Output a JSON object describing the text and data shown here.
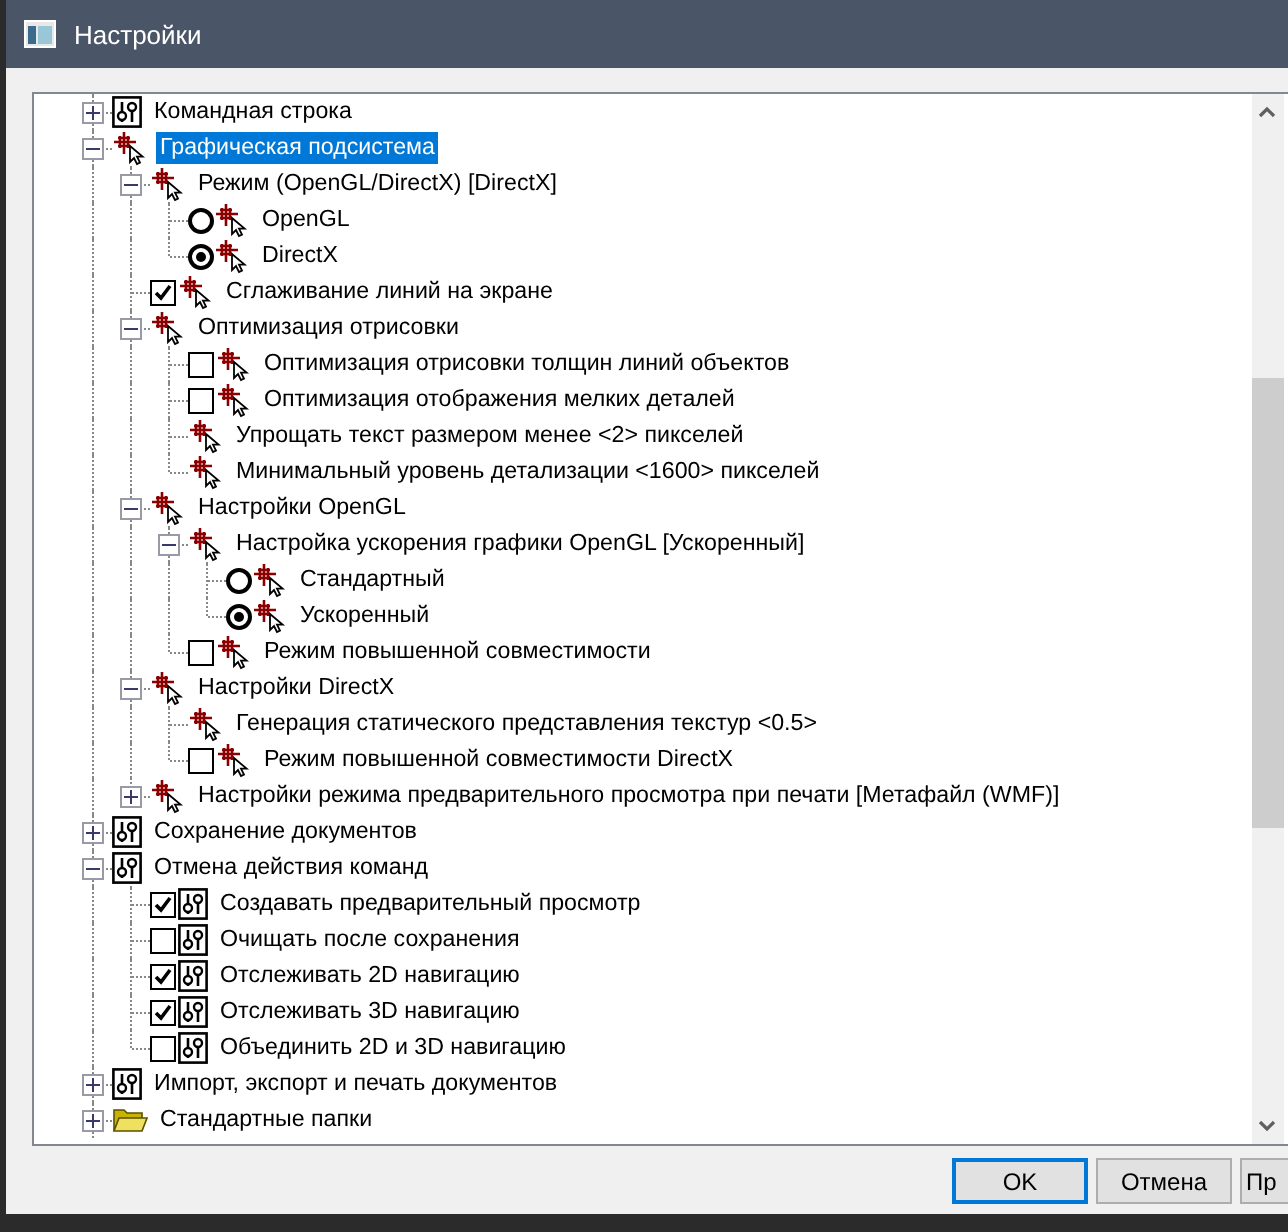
{
  "window": {
    "title": "Настройки"
  },
  "tree": {
    "items": [
      {
        "label": "Командная строка",
        "kind": "tool-node",
        "expanded": false,
        "selected": false
      },
      {
        "label": "Графическая подсистема",
        "kind": "cad-node",
        "expanded": true,
        "selected": true,
        "children": [
          {
            "label": "Режим (OpenGL/DirectX) [DirectX]",
            "kind": "cad-node",
            "expanded": true,
            "selected": false,
            "children": [
              {
                "label": "OpenGL",
                "kind": "cad-radio",
                "checked": false,
                "selected": false
              },
              {
                "label": "DirectX",
                "kind": "cad-radio",
                "checked": true,
                "selected": false
              }
            ]
          },
          {
            "label": "Сглаживание линий на экране",
            "kind": "cad-checkbox",
            "checked": true,
            "selected": false
          },
          {
            "label": "Оптимизация отрисовки",
            "kind": "cad-node",
            "expanded": true,
            "selected": false,
            "children": [
              {
                "label": "Оптимизация отрисовки толщин линий объектов",
                "kind": "cad-checkbox",
                "checked": false,
                "selected": false
              },
              {
                "label": "Оптимизация отображения мелких деталей",
                "kind": "cad-checkbox",
                "checked": false,
                "selected": false
              },
              {
                "label": "Упрощать текст размером менее <2> пикселей",
                "kind": "cad-node",
                "selected": false
              },
              {
                "label": "Минимальный уровень детализации  <1600> пикселей",
                "kind": "cad-node",
                "selected": false
              }
            ]
          },
          {
            "label": "Настройки OpenGL",
            "kind": "cad-node",
            "expanded": true,
            "selected": false,
            "children": [
              {
                "label": "Настройка ускорения графики OpenGL [Ускоренный]",
                "kind": "cad-node",
                "expanded": true,
                "selected": false,
                "children": [
                  {
                    "label": "Стандартный",
                    "kind": "cad-radio",
                    "checked": false,
                    "selected": false
                  },
                  {
                    "label": "Ускоренный",
                    "kind": "cad-radio",
                    "checked": true,
                    "selected": false
                  }
                ]
              },
              {
                "label": "Режим повышенной совместимости",
                "kind": "cad-checkbox",
                "checked": false,
                "selected": false
              }
            ]
          },
          {
            "label": "Настройки DirectX",
            "kind": "cad-node",
            "expanded": true,
            "selected": false,
            "children": [
              {
                "label": "Генерация статического представления текстур <0.5>",
                "kind": "cad-node",
                "selected": false
              },
              {
                "label": "Режим повышенной совместимости DirectX",
                "kind": "cad-checkbox",
                "checked": false,
                "selected": false
              }
            ]
          },
          {
            "label": "Настройки режима предварительного просмотра при печати [Метафайл (WMF)]",
            "kind": "cad-node",
            "expanded": false,
            "selected": false
          }
        ]
      },
      {
        "label": "Сохранение документов",
        "kind": "tool-node",
        "expanded": false,
        "selected": false
      },
      {
        "label": "Отмена действия команд",
        "kind": "tool-node",
        "expanded": true,
        "selected": false,
        "children": [
          {
            "label": "Создавать предварительный просмотр",
            "kind": "tool-checkbox",
            "checked": true,
            "selected": false
          },
          {
            "label": "Очищать после сохранения",
            "kind": "tool-checkbox",
            "checked": false,
            "selected": false
          },
          {
            "label": "Отслеживать 2D навигацию",
            "kind": "tool-checkbox",
            "checked": true,
            "selected": false
          },
          {
            "label": "Отслеживать 3D навигацию",
            "kind": "tool-checkbox",
            "checked": true,
            "selected": false
          },
          {
            "label": "Объединить 2D и 3D навигацию",
            "kind": "tool-checkbox",
            "checked": false,
            "selected": false
          }
        ]
      },
      {
        "label": "Импорт, экспорт и печать документов",
        "kind": "tool-node",
        "expanded": false,
        "selected": false
      },
      {
        "label": "Стандартные папки",
        "kind": "folder-node",
        "expanded": false,
        "selected": false
      }
    ]
  },
  "buttons": [
    {
      "label": "OK",
      "default": true
    },
    {
      "label": "Отмена",
      "default": false
    },
    {
      "label": "Пр",
      "default": false
    }
  ]
}
